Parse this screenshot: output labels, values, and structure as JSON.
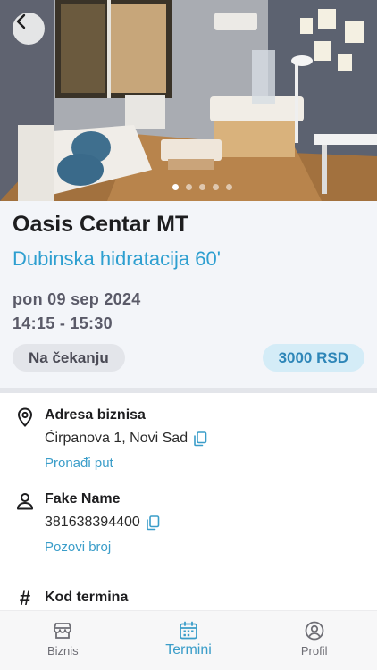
{
  "hero": {
    "image_alt": "Salon interior",
    "slides": [
      true,
      false,
      false,
      false,
      false
    ]
  },
  "business": {
    "name": "Oasis Centar MT",
    "service": "Dubinska hidratacija 60'"
  },
  "appointment": {
    "date": "pon 09 sep 2024",
    "time": "14:15 - 15:30",
    "status": "Na čekanju",
    "price": "3000 RSD"
  },
  "address": {
    "title": "Adresa biznisa",
    "value": "Ćirpanova 1, Novi Sad",
    "link": "Pronađi put"
  },
  "contact": {
    "title": "Fake Name",
    "phone": "381638394400",
    "link": "Pozovi broj"
  },
  "code": {
    "title": "Kod termina"
  },
  "tabs": [
    {
      "label": "Biznis",
      "icon": "store-icon"
    },
    {
      "label": "Termini",
      "icon": "calendar-icon"
    },
    {
      "label": "Profil",
      "icon": "profile-icon"
    }
  ],
  "colors": {
    "accent": "#2e9fd0",
    "status_bg": "#e3e5ea",
    "price_bg": "#d4ecf7"
  }
}
